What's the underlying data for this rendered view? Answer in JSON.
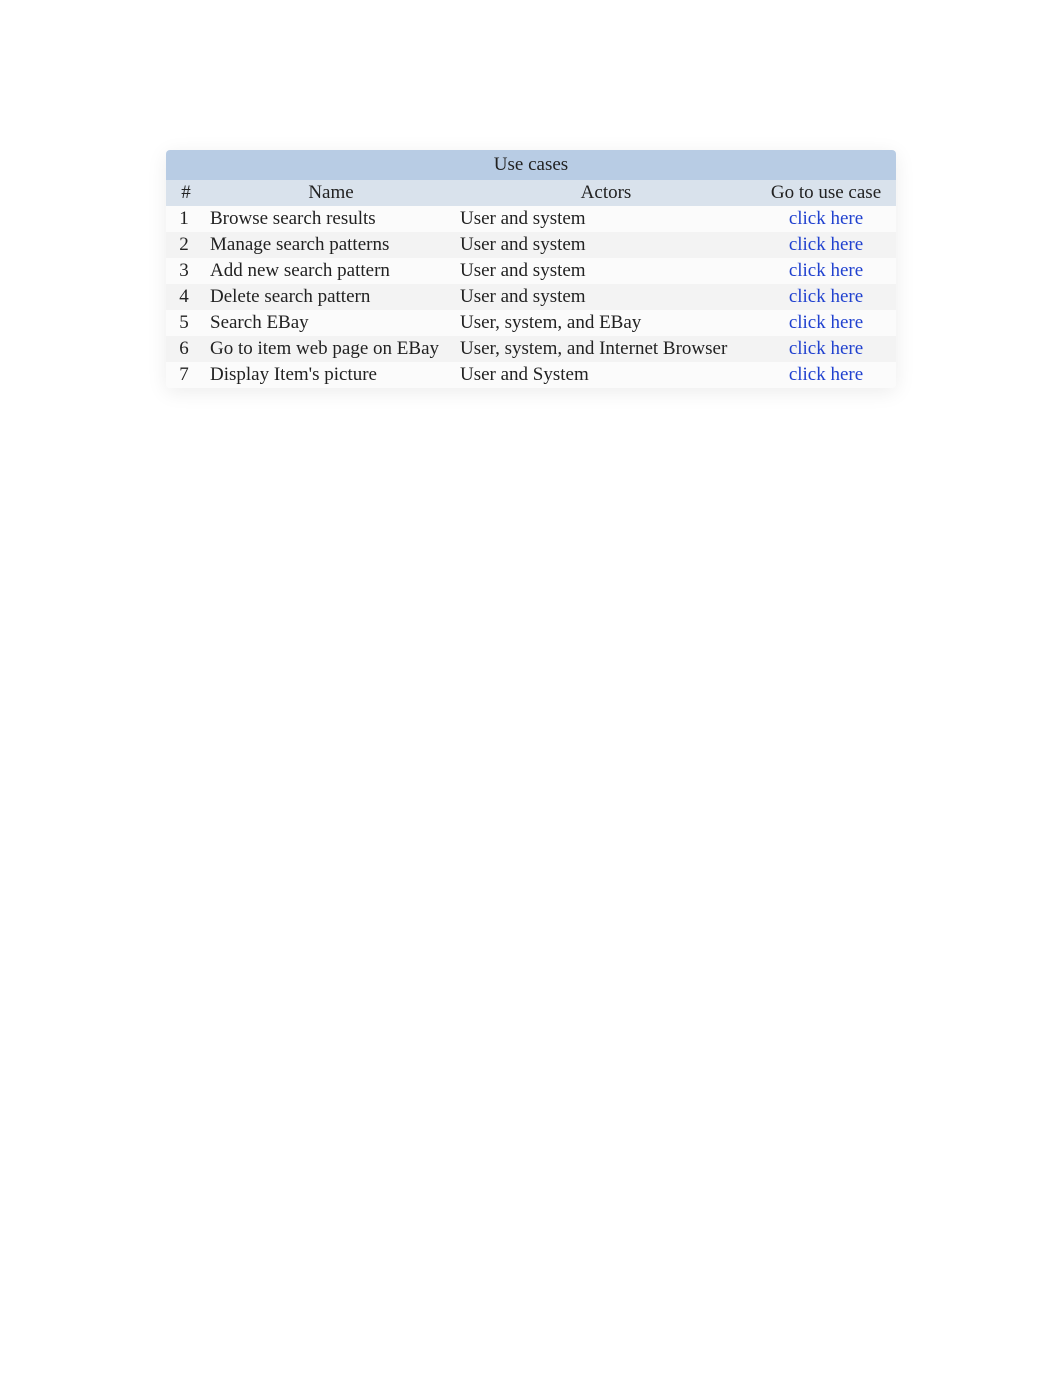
{
  "table": {
    "title": "Use cases",
    "headers": {
      "num": "#",
      "name": "Name",
      "actors": "Actors",
      "link": "Go to use case"
    },
    "rows": [
      {
        "num": "1",
        "name": "Browse search results",
        "actors": "User and system",
        "link": "click here"
      },
      {
        "num": "2",
        "name": "Manage search patterns",
        "actors": "User and system",
        "link": "click here"
      },
      {
        "num": "3",
        "name": "Add new search pattern",
        "actors": "User and system",
        "link": "click here"
      },
      {
        "num": "4",
        "name": "Delete search pattern",
        "actors": "User and system",
        "link": "click here"
      },
      {
        "num": "5",
        "name": "Search EBay",
        "actors": "User, system, and EBay",
        "link": "click here"
      },
      {
        "num": "6",
        "name": "Go to item web page on EBay",
        "actors": "User, system, and Internet Browser",
        "link": "click here"
      },
      {
        "num": "7",
        "name": "Display Item's picture",
        "actors": "User and System",
        "link": "click here"
      }
    ]
  }
}
